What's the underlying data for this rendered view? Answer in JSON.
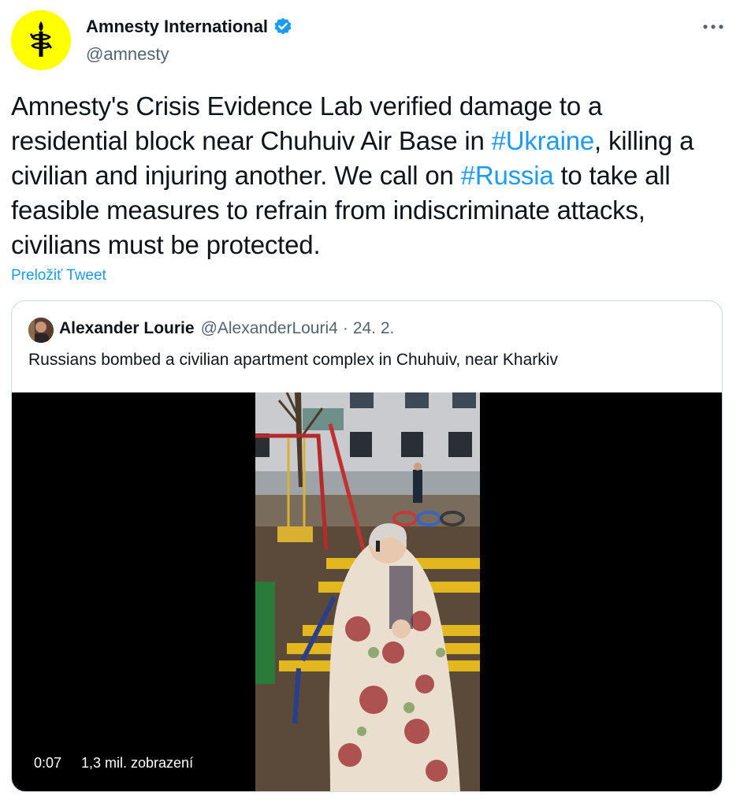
{
  "colors": {
    "link": "#1d9bf0",
    "text": "#0f1419",
    "muted": "#536471",
    "brand_yellow": "#ffff00",
    "border": "#cfd9de"
  },
  "author": {
    "name": "Amnesty International",
    "handle": "@amnesty",
    "avatar_icon": "amnesty-candle-logo",
    "verified_icon": "verified-badge-icon"
  },
  "menu": {
    "icon": "more-icon"
  },
  "tweet": {
    "segments": [
      "Amnesty's Crisis Evidence Lab verified damage to a residential block near Chuhuiv Air Base in ",
      "#Ukraine",
      ", killing a civilian and injuring another. We call on ",
      "#Russia",
      " to take all feasible measures to refrain from indiscriminate attacks, civilians must be protected."
    ],
    "translate_label": "Preložiť Tweet"
  },
  "quote": {
    "name": "Alexander Lourie",
    "handle": "@AlexanderLouri4",
    "separator": "·",
    "date": "24. 2.",
    "text": "Russians bombed a civilian apartment complex in Chuhuiv, near Kharkiv",
    "video": {
      "time": "0:07",
      "views": "1,3 mil. zobrazení"
    }
  }
}
